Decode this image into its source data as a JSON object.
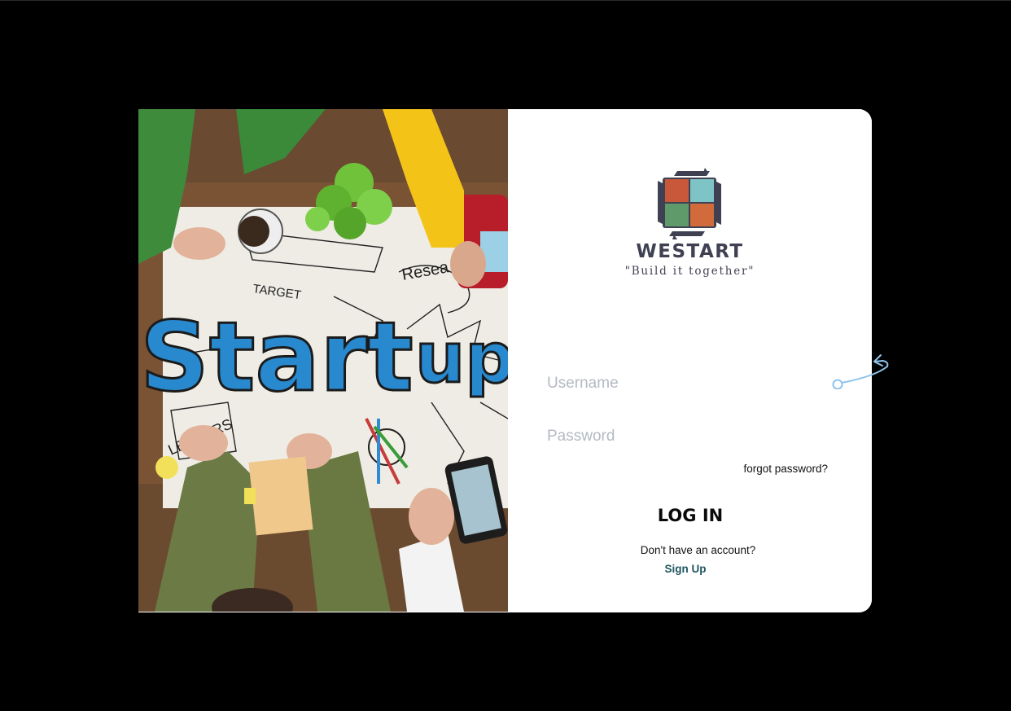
{
  "hero": {
    "words": {
      "start": "Start",
      "up": "up",
      "target": "TARGET",
      "research": "Resea",
      "leaders": "LEADERS"
    }
  },
  "brand": {
    "name": "WESTART",
    "tagline": "\"Build it together\"",
    "logo_icon": "books-grid-logo",
    "colors": {
      "tile_red": "#c9573a",
      "tile_teal": "#7ec3c6",
      "tile_green": "#5f9b6a",
      "tile_orange": "#d16b3b",
      "ink": "#3f4153"
    }
  },
  "form": {
    "username_placeholder": "Username",
    "password_placeholder": "Password",
    "forgot_label": "forgot password?",
    "login_label": "LOG IN",
    "no_account_text": "Don't have an account?",
    "signup_label": "Sign Up"
  },
  "colors": {
    "background": "#000000",
    "card": "#ffffff",
    "placeholder": "#b4b9c2",
    "signup": "#1f5560",
    "cursor_marker": "#8fc4ec"
  }
}
